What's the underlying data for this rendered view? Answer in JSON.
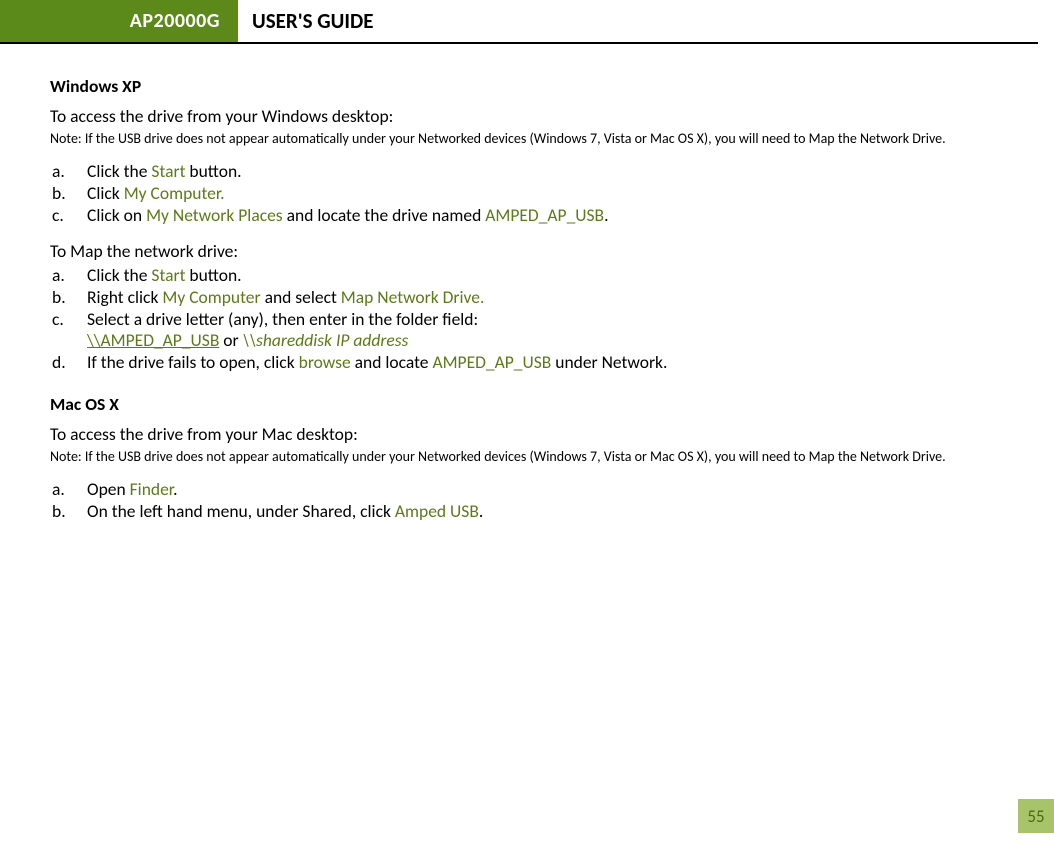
{
  "header": {
    "model": "AP20000G",
    "title": "USER'S GUIDE"
  },
  "winxp": {
    "heading": "Windows XP",
    "intro": "To access the drive from your Windows desktop:",
    "note": "Note: If the USB drive does not appear automatically under your Networked devices (Windows 7, Vista or Mac OS X), you will need to Map the Network Drive.",
    "a_m": "a.",
    "a_t1": "Click the ",
    "a_olv": "Start",
    "a_t2": " button.",
    "b_m": "b.",
    "b_t1": "Click ",
    "b_olv": "My Computer.",
    "c_m": "c.",
    "c_t1": "Click on ",
    "c_olv1": "My Network Places",
    "c_t2": " and locate the drive named ",
    "c_olv2": "AMPED_AP_USB",
    "c_t3": ".",
    "map_intro": "To Map the network drive:",
    "ma_m": "a.",
    "ma_t1": "Click the ",
    "ma_olv": "Start",
    "ma_t2": " button.",
    "mb_m": "b.",
    "mb_t1": "Right click ",
    "mb_olv1": "My Computer",
    "mb_t2": " and select ",
    "mb_olv2": "Map Network Drive.",
    "mc_m": "c.",
    "mc_t1": "Select a drive letter (any), then enter in the folder field:",
    "mc_l2_olv1": "\\\\AMPED_AP_USB",
    "mc_l2_t1": "  or  ",
    "mc_l2_olv2": "\\\\shareddisk IP address",
    "md_m": "d.",
    "md_t1": "If the drive fails to open, click ",
    "md_olv1": "browse",
    "md_t2": " and locate ",
    "md_olv2": "AMPED_AP_USB",
    "md_t3": " under Network."
  },
  "mac": {
    "heading": "Mac OS X",
    "intro": "To access the drive from your Mac desktop:",
    "note": "Note: If the USB drive does not appear automatically under your Networked devices (Windows 7, Vista or Mac OS X), you will need to Map the Network Drive.",
    "a_m": "a.",
    "a_t1": "Open ",
    "a_olv": "Finder",
    "a_t2": ".",
    "b_m": "b.",
    "b_t1": "On the left hand menu, under Shared, click ",
    "b_olv": "Amped USB",
    "b_t2": "."
  },
  "page_number": "55"
}
